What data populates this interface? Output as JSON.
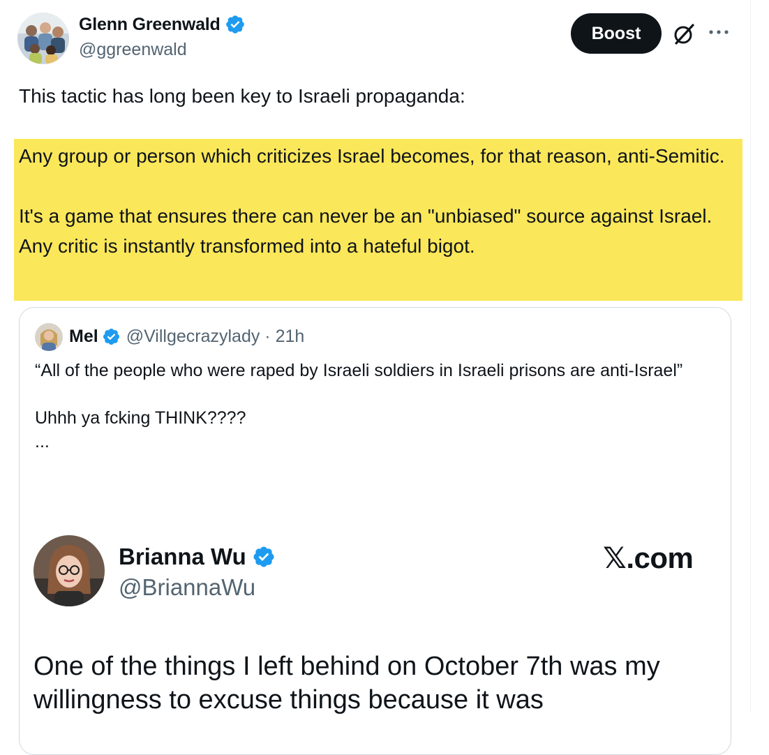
{
  "author": {
    "name": "Glenn Greenwald",
    "handle": "@ggreenwald",
    "avatar_icon": "avatar-photo",
    "verified_icon": "verified-badge-icon"
  },
  "actions": {
    "boost_label": "Boost",
    "grok_icon": "grok-icon",
    "more_icon": "more-icon"
  },
  "tweet": {
    "lead": "This tactic has long been key to Israeli propaganda:",
    "highlighted_para_1": "Any group or person which criticizes Israel becomes, for that reason, anti-Semitic.",
    "highlighted_para_2": "It's a game that ensures there can never be an \"unbiased\" source against Israel. Any critic is instantly transformed into a hateful bigot."
  },
  "quoted": {
    "name": "Mel",
    "meta": "@Villgecrazylady · 21h",
    "line_1": "“All of the people who were raped by Israeli soldiers in Israeli prisons are anti-Israel”",
    "line_2": "Uhhh ya fcking THINK????",
    "ellipsis": "...",
    "embedded": {
      "name": "Brianna Wu",
      "handle": "@BriannaWu",
      "source": "𝕏.com",
      "text": "One of the things I left behind on October 7th was my willingness to excuse things because it was"
    }
  },
  "colors": {
    "highlight": "#fbe75a",
    "verified_blue": "#1d9bf0",
    "boost_bg": "#0f1419",
    "secondary_text": "#536471"
  }
}
